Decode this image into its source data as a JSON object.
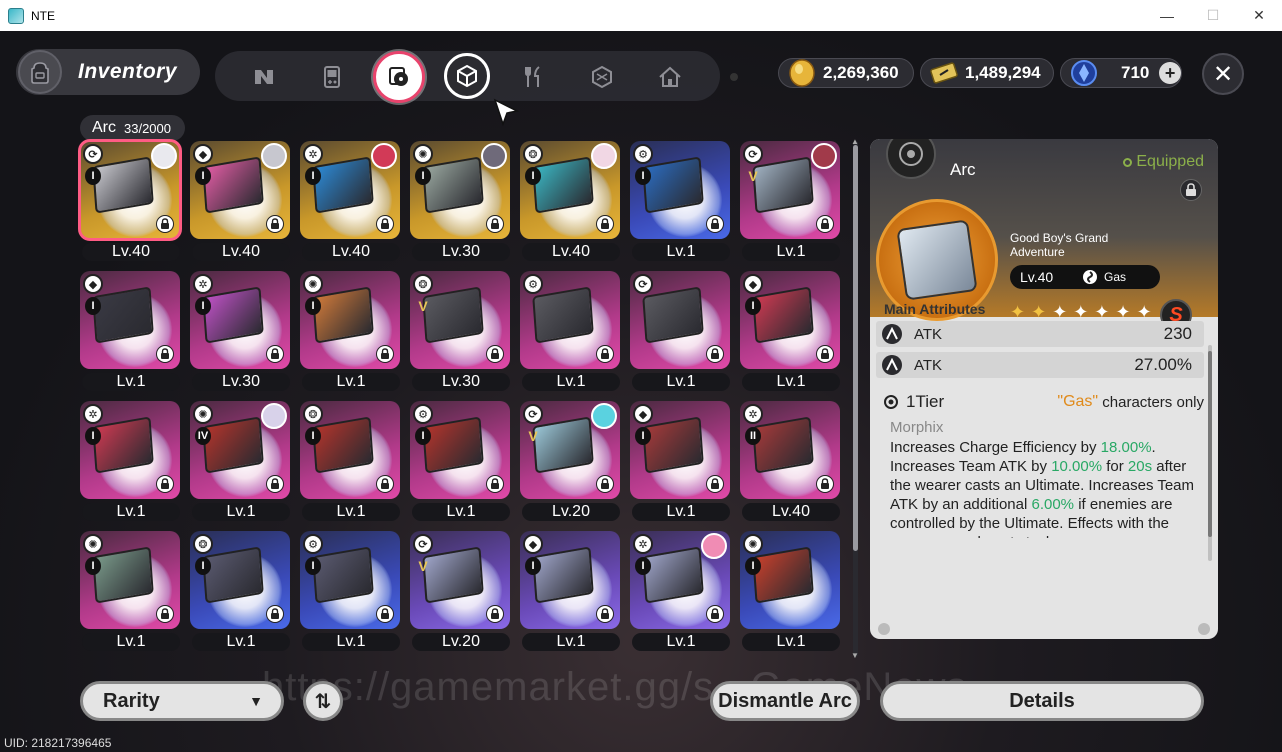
{
  "window": {
    "title": "NTE",
    "minimize": "—",
    "maximize": "☐",
    "close": "✕"
  },
  "header": {
    "title": "Inventory"
  },
  "tabs": [
    {
      "icon": "n-logo-icon"
    },
    {
      "icon": "gameboy-icon"
    },
    {
      "icon": "arc-record-icon",
      "active": true
    },
    {
      "icon": "cube-icon",
      "hover": true
    },
    {
      "icon": "fork-knife-icon"
    },
    {
      "icon": "box-icon"
    },
    {
      "icon": "house-icon"
    }
  ],
  "currencies": [
    {
      "icon": "gold-coin-icon",
      "value": "2,269,360"
    },
    {
      "icon": "ticket-icon",
      "value": "1,489,294"
    },
    {
      "icon": "blue-crystal-icon",
      "value": "710",
      "plus": "+"
    }
  ],
  "close_label": "✕",
  "arc_list": {
    "label": "Arc",
    "count": "33/2000"
  },
  "cards": [
    {
      "level": "Lv.40",
      "tier": "I",
      "rarity": "gold",
      "avatar": true,
      "avatar_color": "#e9e9ee",
      "art": "#c9c9cf",
      "selected": true
    },
    {
      "level": "Lv.40",
      "tier": "I",
      "rarity": "gold",
      "avatar": true,
      "avatar_color": "#c7c7cf",
      "art": "#e35da5"
    },
    {
      "level": "Lv.40",
      "tier": "I",
      "rarity": "gold",
      "avatar": true,
      "avatar_color": "#d23a57",
      "art": "#2c8ad6"
    },
    {
      "level": "Lv.30",
      "tier": "I",
      "rarity": "gold",
      "avatar": true,
      "avatar_color": "#6f6a7a",
      "art": "#9aa8a0"
    },
    {
      "level": "Lv.40",
      "tier": "I",
      "rarity": "gold",
      "avatar": true,
      "avatar_color": "#f1d7e4",
      "art": "#3bb7c4"
    },
    {
      "level": "Lv.1",
      "tier": "I",
      "rarity": "blue",
      "avatar": false,
      "art": "#2b6cc0"
    },
    {
      "level": "Lv.1",
      "tier": "V",
      "rarity": "pink",
      "avatar": true,
      "avatar_color": "#a13a4a",
      "art": "#9fb0c0"
    },
    {
      "level": "Lv.1",
      "tier": "I",
      "rarity": "pink",
      "avatar": false,
      "art": "#3a3a44"
    },
    {
      "level": "Lv.30",
      "tier": "I",
      "rarity": "pink",
      "avatar": false,
      "art": "#c052c7"
    },
    {
      "level": "Lv.1",
      "tier": "I",
      "rarity": "pink",
      "avatar": false,
      "art": "#d07a3a"
    },
    {
      "level": "Lv.30",
      "tier": "V",
      "rarity": "pink",
      "avatar": false,
      "art": "#5a5a60"
    },
    {
      "level": "Lv.1",
      "tier": "",
      "rarity": "pink",
      "avatar": false,
      "art": "#5a5a60"
    },
    {
      "level": "Lv.1",
      "tier": "",
      "rarity": "pink",
      "avatar": false,
      "art": "#5a5a60"
    },
    {
      "level": "Lv.1",
      "tier": "I",
      "rarity": "pink",
      "avatar": false,
      "art": "#cf3a52"
    },
    {
      "level": "Lv.1",
      "tier": "I",
      "rarity": "pink",
      "avatar": false,
      "art": "#cf3a52"
    },
    {
      "level": "Lv.1",
      "tier": "IV",
      "rarity": "pink",
      "avatar": true,
      "avatar_color": "#d8d2ea",
      "art": "#b3342c"
    },
    {
      "level": "Lv.1",
      "tier": "I",
      "rarity": "pink",
      "avatar": false,
      "art": "#b3342c"
    },
    {
      "level": "Lv.1",
      "tier": "I",
      "rarity": "pink",
      "avatar": false,
      "art": "#b3342c"
    },
    {
      "level": "Lv.20",
      "tier": "V",
      "rarity": "pink",
      "avatar": true,
      "avatar_color": "#5ad2e0",
      "art": "#9ac6d6"
    },
    {
      "level": "Lv.1",
      "tier": "I",
      "rarity": "pink",
      "avatar": false,
      "art": "#a53a3a"
    },
    {
      "level": "Lv.40",
      "tier": "II",
      "rarity": "pink",
      "avatar": false,
      "art": "#a53a3a"
    },
    {
      "level": "Lv.1",
      "tier": "I",
      "rarity": "pink",
      "avatar": false,
      "art": "#7a9a8a"
    },
    {
      "level": "Lv.1",
      "tier": "I",
      "rarity": "blue",
      "avatar": false,
      "art": "#5a5a70"
    },
    {
      "level": "Lv.1",
      "tier": "I",
      "rarity": "blue",
      "avatar": false,
      "art": "#5a5a70"
    },
    {
      "level": "Lv.20",
      "tier": "V",
      "rarity": "purple",
      "avatar": false,
      "art": "#9ea4c8"
    },
    {
      "level": "Lv.1",
      "tier": "I",
      "rarity": "purple",
      "avatar": false,
      "art": "#9ea4c8"
    },
    {
      "level": "Lv.1",
      "tier": "I",
      "rarity": "purple",
      "avatar": true,
      "avatar_color": "#f08cb4",
      "art": "#9ea4c8"
    },
    {
      "level": "Lv.1",
      "tier": "I",
      "rarity": "blue",
      "avatar": false,
      "art": "#c8402c"
    }
  ],
  "detail": {
    "title": "Arc",
    "status": "Equipped",
    "item_name": "Good Boy's Grand Adventure",
    "level": "Lv.40",
    "element": "Gas",
    "stars_total": 7,
    "stars_on": 2,
    "rank_badge": "S",
    "main_attributes_label": "Main Attributes",
    "attributes": [
      {
        "name": "ATK",
        "value": "230"
      },
      {
        "name": "ATK",
        "value": "27.00%"
      }
    ],
    "tier_label": "1Tier",
    "restriction_quoted": "\"Gas\"",
    "restriction_rest": " characters only",
    "effect_name": "Morphix",
    "effect": {
      "p1": "Increases Charge Efficiency by ",
      "v1": "18.00%",
      "p2": ". Increases Team ATK by ",
      "v2": "10.00%",
      "p3": " for ",
      "v3": "20s",
      "p4": " after the wearer casts an Ultimate. Increases Team ATK by an additional ",
      "v4": "6.00%",
      "p5": " if enemies are controlled by the Ultimate. Effects with the same name do not stack."
    }
  },
  "footer": {
    "rarity_label": "Rarity",
    "rarity_caret": "▼",
    "sort_label": "⇅",
    "dismantle_label": "Dismantle Arc",
    "details_label": "Details",
    "uid": "UID: 218217396465"
  },
  "watermark": "https://gamemarket.gg/s...GameNews",
  "colors": {
    "accent": "#ff5c84",
    "gold_currency": "#e7b53a",
    "effect_green": "#29a865",
    "element_orange": "#e08a1a",
    "equipped_green": "#8bb04a"
  }
}
